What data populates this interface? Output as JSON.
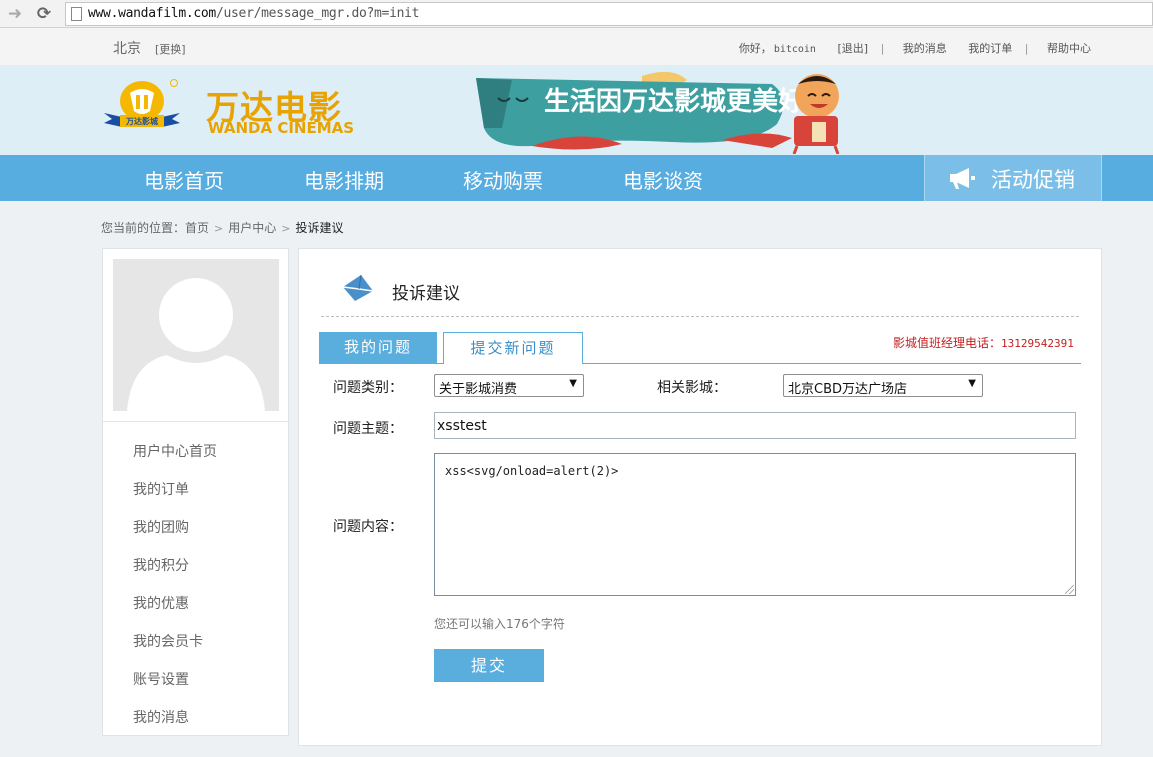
{
  "browser": {
    "url_host": "www.wandafilm.com",
    "url_path": "/user/message_mgr.do?m=init"
  },
  "topbar": {
    "city": "北京",
    "change_city": "[更换]",
    "greeting": "你好，",
    "username": "bitcoin",
    "logout": "[退出]",
    "my_messages": "我的消息",
    "my_orders": "我的订单",
    "help_center": "帮助中心",
    "separator": "|"
  },
  "header": {
    "logo_cn": "万达电影",
    "logo_en": "WANDA CINEMAS",
    "banner_text": "生活因万达影城更美好"
  },
  "nav": {
    "items": [
      "电影首页",
      "电影排期",
      "移动购票",
      "电影谈资"
    ],
    "promo": "活动促销"
  },
  "breadcrumb": {
    "prefix": "您当前的位置：",
    "home": "首页",
    "user_center": "用户中心",
    "current": "投诉建议",
    "separator": ">"
  },
  "sidebar": {
    "items": [
      "用户中心首页",
      "我的订单",
      "我的团购",
      "我的积分",
      "我的优惠",
      "我的会员卡",
      "账号设置",
      "我的消息"
    ]
  },
  "main": {
    "title": "投诉建议",
    "tabs": [
      "我的问题",
      "提交新问题"
    ],
    "hotline_label": "影城值班经理电话：",
    "hotline_number": "13129542391",
    "form": {
      "category_label": "问题类别：",
      "category_value": "关于影城消费",
      "cinema_label": "相关影城：",
      "cinema_value": "北京CBD万达广场店",
      "subject_label": "问题主题：",
      "subject_value": "xsstest",
      "content_label": "问题内容：",
      "content_value": "xss<svg/onload=alert(2)>",
      "char_count": "您还可以输入176个字符",
      "submit": "提交"
    }
  },
  "colors": {
    "nav_blue": "#57ace0",
    "accent_blue": "#5aaede",
    "logo_gold": "#e8a300",
    "hotline_red": "#c31f1f"
  },
  "icons": [
    "back-arrow-icon",
    "reload-icon",
    "page-icon",
    "megaphone-icon",
    "envelope-icon",
    "user-silhouette-icon"
  ]
}
